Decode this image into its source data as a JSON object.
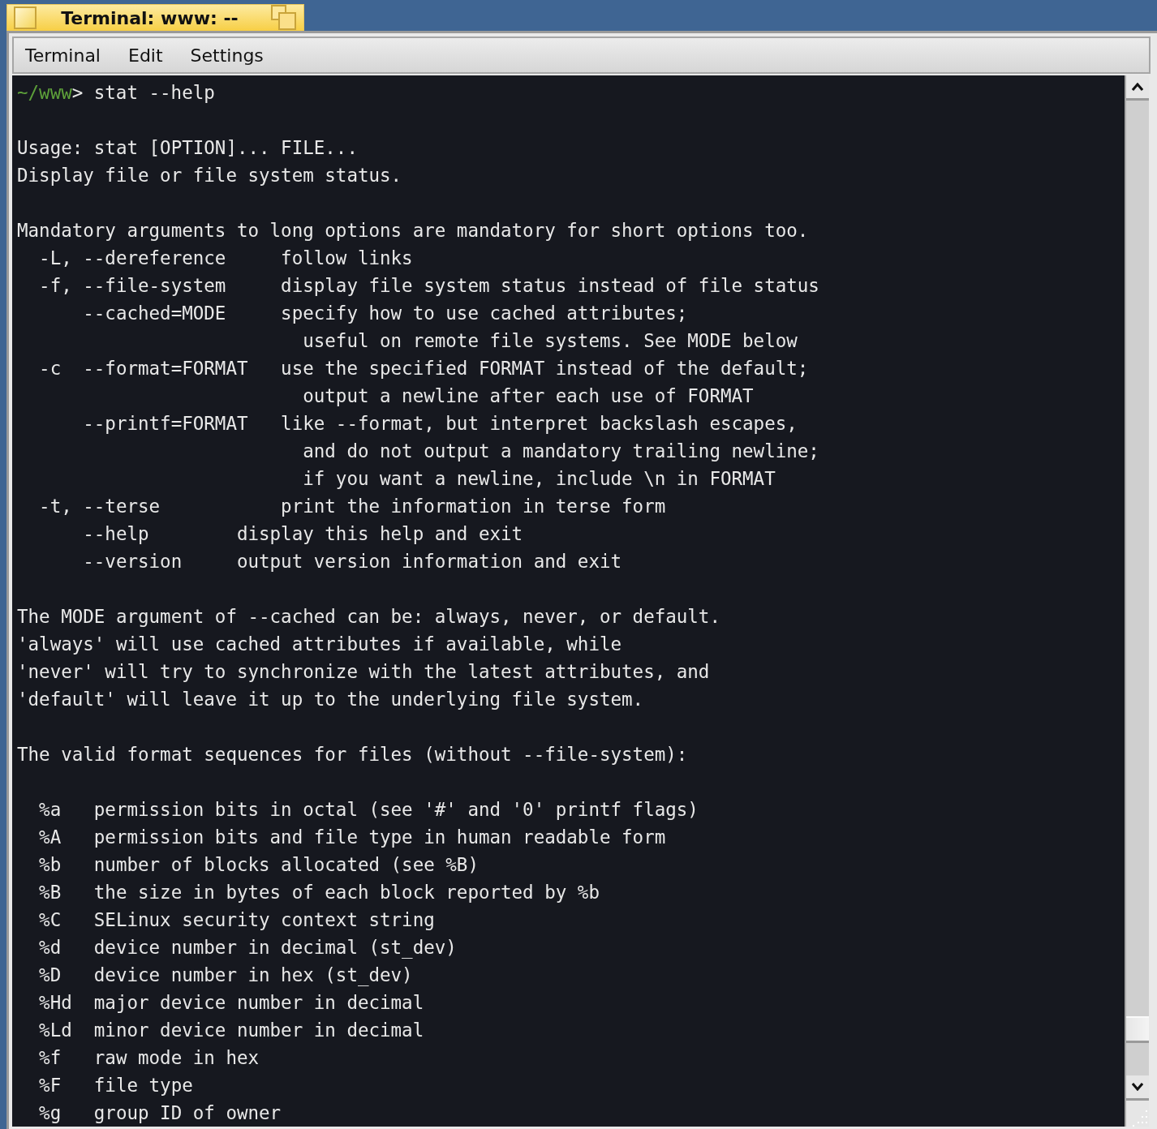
{
  "window": {
    "title": "Terminal: www: --"
  },
  "menu": [
    {
      "label": "Terminal"
    },
    {
      "label": "Edit"
    },
    {
      "label": "Settings"
    }
  ],
  "terminal": {
    "prompt": {
      "path": "~/www",
      "symbol": ">",
      "command": "stat --help"
    },
    "blocks": [
      [
        "Usage: stat [OPTION]... FILE...",
        "Display file or file system status."
      ],
      [
        "Mandatory arguments to long options are mandatory for short options too.",
        "  -L, --dereference     follow links",
        "  -f, --file-system     display file system status instead of file status",
        "      --cached=MODE     specify how to use cached attributes;",
        "                          useful on remote file systems. See MODE below",
        "  -c  --format=FORMAT   use the specified FORMAT instead of the default;",
        "                          output a newline after each use of FORMAT",
        "      --printf=FORMAT   like --format, but interpret backslash escapes,",
        "                          and do not output a mandatory trailing newline;",
        "                          if you want a newline, include \\n in FORMAT",
        "  -t, --terse           print the information in terse form",
        "      --help        display this help and exit",
        "      --version     output version information and exit"
      ],
      [
        "The MODE argument of --cached can be: always, never, or default.",
        "'always' will use cached attributes if available, while",
        "'never' will try to synchronize with the latest attributes, and",
        "'default' will leave it up to the underlying file system."
      ],
      [
        "The valid format sequences for files (without --file-system):"
      ],
      [
        "  %a   permission bits in octal (see '#' and '0' printf flags)",
        "  %A   permission bits and file type in human readable form",
        "  %b   number of blocks allocated (see %B)",
        "  %B   the size in bytes of each block reported by %b",
        "  %C   SELinux security context string",
        "  %d   device number in decimal (st_dev)",
        "  %D   device number in hex (st_dev)",
        "  %Hd  major device number in decimal",
        "  %Ld  minor device number in decimal",
        "  %f   raw mode in hex",
        "  %F   file type",
        "  %g   group ID of owner"
      ]
    ]
  }
}
